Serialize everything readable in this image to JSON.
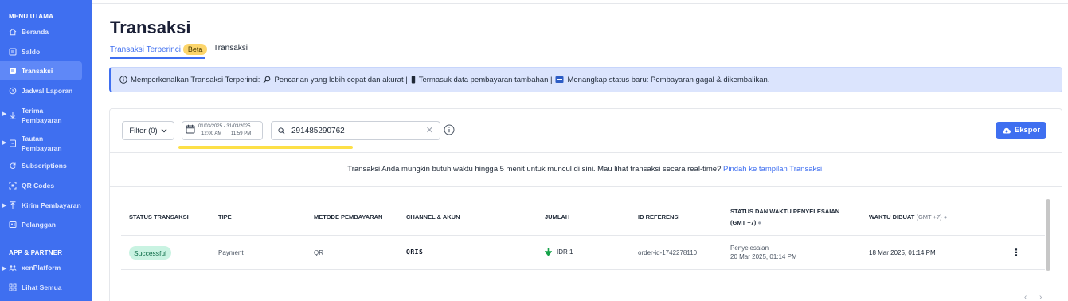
{
  "sidebar": {
    "section_main": "MENU UTAMA",
    "section_partner": "APP & PARTNER",
    "items": [
      {
        "label": "Beranda",
        "icon": "home-icon"
      },
      {
        "label": "Saldo",
        "icon": "wallet-icon"
      },
      {
        "label": "Transaksi",
        "icon": "transaction-icon",
        "active": true
      },
      {
        "label": "Jadwal Laporan",
        "icon": "schedule-icon"
      },
      {
        "label": "Terima Pembayaran",
        "icon": "receive-icon",
        "expandable": true
      },
      {
        "label": "Tautan Pembayaran",
        "icon": "link-icon",
        "expandable": true
      },
      {
        "label": "Subscriptions",
        "icon": "refresh-icon"
      },
      {
        "label": "QR Codes",
        "icon": "qr-icon"
      },
      {
        "label": "Kirim Pembayaran",
        "icon": "send-icon",
        "expandable": true
      },
      {
        "label": "Pelanggan",
        "icon": "customer-icon"
      },
      {
        "label": "xenPlatform",
        "icon": "platform-icon",
        "expandable": true
      },
      {
        "label": "Lihat Semua",
        "icon": "grid-icon"
      }
    ]
  },
  "page": {
    "title": "Transaksi",
    "tabs": [
      {
        "label": "Transaksi Terperinci",
        "badge": "Beta",
        "active": true
      },
      {
        "label": "Transaksi"
      }
    ]
  },
  "banner": {
    "intro": "Memperkenalkan Transaksi Terperinci:",
    "part1": "Pencarian yang lebih cepat dan akurat |",
    "part2": "Termasuk data pembayaran tambahan |",
    "part3": "Menangkap status baru: Pembayaran gagal & dikembalikan."
  },
  "toolbar": {
    "filter_label": "Filter (0)",
    "date_range": {
      "start_date": "01/03/2025",
      "end_date": "31/03/2025",
      "start_time": "12:00 AM",
      "end_time": "11:59 PM",
      "separator": "-"
    },
    "search_value": "291485290762",
    "export_label": "Ekspor"
  },
  "notice": {
    "text": "Transaksi Anda mungkin butuh waktu hingga 5 menit untuk muncul di sini. Mau lihat transaksi secara real-time?",
    "link": "Pindah ke tampilan Transaksi!"
  },
  "table": {
    "headers": {
      "status": "STATUS TRANSAKSI",
      "type": "TIPE",
      "method": "METODE PEMBAYARAN",
      "channel": "CHANNEL & AKUN",
      "amount": "JUMLAH",
      "reference": "ID REFERENSI",
      "settlement_line1": "STATUS DAN WAKTU PENYELESAIAN",
      "settlement_line2": "(GMT +7)",
      "created": "WAKTU DIBUAT",
      "created_tz": "(GMT +7)"
    },
    "rows": [
      {
        "status": "Successful",
        "type": "Payment",
        "method": "QR",
        "channel": "QRIS",
        "amount": "IDR 1",
        "reference": "order-id-1742278110",
        "settlement_status": "Penyelesaian",
        "settlement_time": "20 Mar 2025, 01:14 PM",
        "created": "18 Mar 2025, 01:14 PM"
      }
    ]
  },
  "colors": {
    "primary": "#3f6ff0",
    "success_bg": "#c9f3e2",
    "success_text": "#0b6b46",
    "beta_badge": "#fcd56b",
    "highlight": "#fde047",
    "banner_bg": "#dbe4fd"
  }
}
